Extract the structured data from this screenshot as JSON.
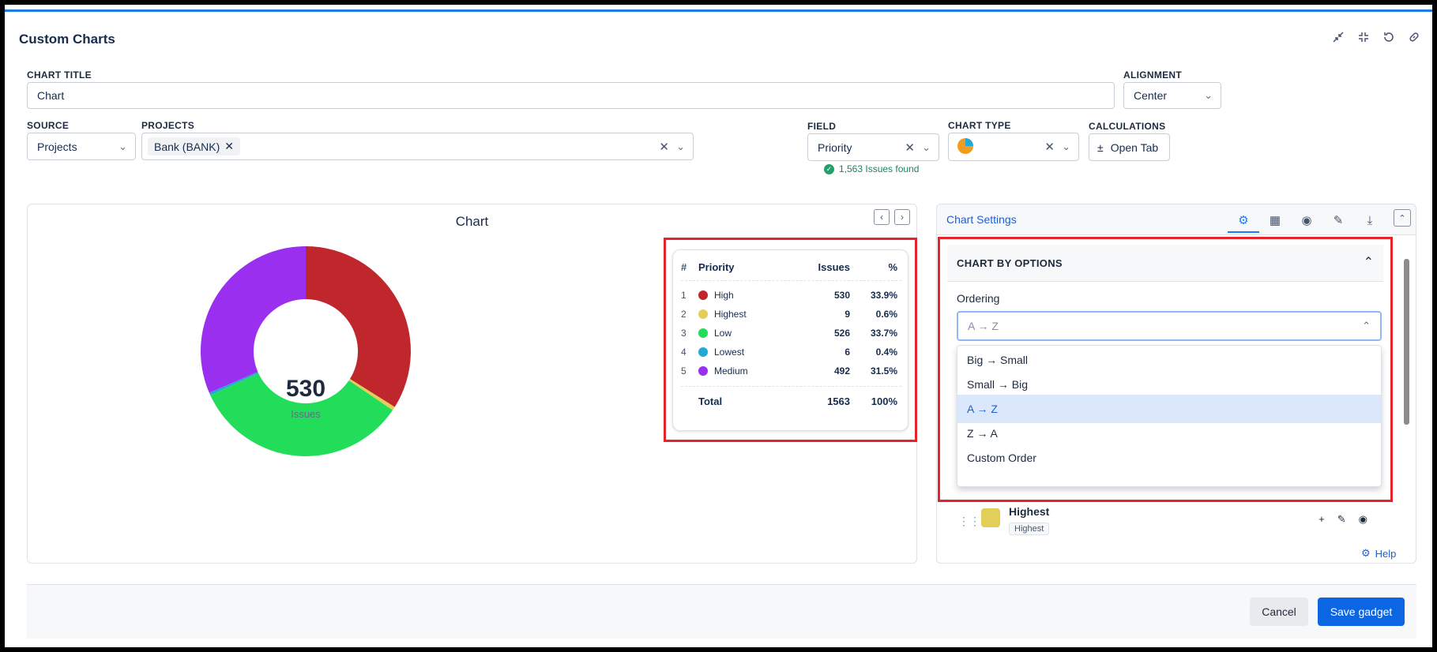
{
  "window": {
    "title": "Custom Charts",
    "icons": [
      "shrink-icon",
      "minimize-icon",
      "refresh-icon",
      "link-icon"
    ]
  },
  "form": {
    "chart_title_label": "CHART TITLE",
    "chart_title_value": "Chart",
    "alignment_label": "ALIGNMENT",
    "alignment_value": "Center",
    "source_label": "SOURCE",
    "source_value": "Projects",
    "projects_label": "PROJECTS",
    "projects_tag": "Bank (BANK)",
    "issues_found": "1,563 Issues found",
    "field_label": "FIELD",
    "field_value": "Priority",
    "chart_type_label": "CHART TYPE",
    "calculations_label": "CALCULATIONS",
    "open_tab_label": "Open Tab"
  },
  "chart": {
    "title": "Chart",
    "center_value": "530",
    "center_label": "Issues"
  },
  "chart_data": {
    "type": "pie",
    "title": "Chart",
    "categories": [
      "High",
      "Highest",
      "Low",
      "Lowest",
      "Medium"
    ],
    "values": [
      530,
      9,
      526,
      6,
      492
    ],
    "colors": [
      "#c0272d",
      "#e2cf58",
      "#22dd5a",
      "#23a9d6",
      "#9b2ff0"
    ]
  },
  "priority_table": {
    "headers": [
      "#",
      "Priority",
      "Issues",
      "%"
    ],
    "rows": [
      {
        "num": "1",
        "name": "High",
        "issues": "530",
        "pct": "33.9%",
        "color": "#c0272d"
      },
      {
        "num": "2",
        "name": "Highest",
        "issues": "9",
        "pct": "0.6%",
        "color": "#e2cf58"
      },
      {
        "num": "3",
        "name": "Low",
        "issues": "526",
        "pct": "33.7%",
        "color": "#22dd5a"
      },
      {
        "num": "4",
        "name": "Lowest",
        "issues": "6",
        "pct": "0.4%",
        "color": "#23a9d6"
      },
      {
        "num": "5",
        "name": "Medium",
        "issues": "492",
        "pct": "31.5%",
        "color": "#9b2ff0"
      }
    ],
    "total": {
      "label": "Total",
      "issues": "1563",
      "pct": "100%"
    }
  },
  "settings": {
    "title": "Chart Settings",
    "section_title": "CHART BY OPTIONS",
    "ordering_label": "Ordering",
    "ordering_value": "A → Z",
    "ordering_options": [
      "Big → Small",
      "Small → Big",
      "A → Z",
      "Z → A",
      "Custom Order"
    ],
    "selected_option": "A → Z",
    "list_item_name": "Highest",
    "list_item_chip": "Highest",
    "help_label": "Help"
  },
  "footer": {
    "cancel_label": "Cancel",
    "save_label": "Save gadget"
  }
}
